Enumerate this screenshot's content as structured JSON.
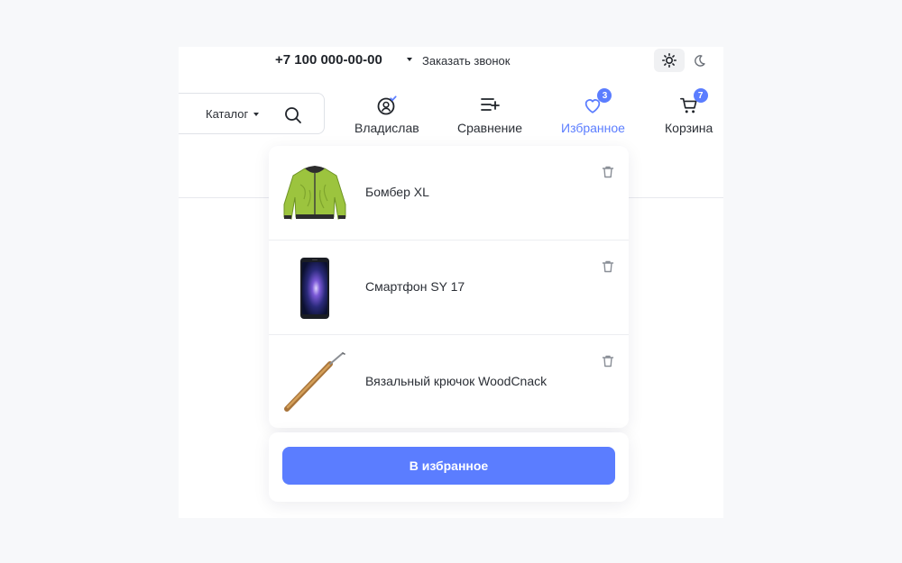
{
  "topbar": {
    "phone": "+7 100 000-00-00",
    "callback": "Заказать звонок"
  },
  "search": {
    "catalog_label": "Каталог"
  },
  "nav": {
    "profile": {
      "label": "Владислав",
      "icon": "user-check-icon"
    },
    "compare": {
      "label": "Сравнение",
      "icon": "compare-list-icon"
    },
    "favorites": {
      "label": "Избранное",
      "icon": "heart-icon",
      "count": "3"
    },
    "cart": {
      "label": "Корзина",
      "icon": "cart-icon",
      "count": "7"
    }
  },
  "favorites_dropdown": {
    "items": [
      {
        "name": "Бомбер XL",
        "image": "green-bomber-jacket"
      },
      {
        "name": "Смартфон SY 17",
        "image": "smartphone"
      },
      {
        "name": "Вязальный крючок WoodCnack",
        "image": "wooden-crochet-hook"
      }
    ],
    "button_label": "В избранное"
  },
  "colors": {
    "accent": "#5b7dff",
    "background": "#f7f8fa",
    "surface": "#ffffff"
  }
}
